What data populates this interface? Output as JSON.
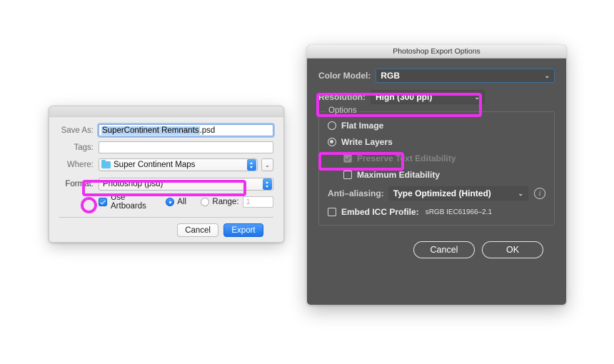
{
  "save_dialog": {
    "name": "macos-save-sheet",
    "save_as": {
      "label": "Save As:",
      "selected_text": "SuperContinent Remnants",
      "extension": ".psd",
      "full_value": "SuperContinent Remnants.psd"
    },
    "tags": {
      "label": "Tags:",
      "value": ""
    },
    "where": {
      "label": "Where:",
      "value": "Super Continent Maps",
      "folder_icon": "folder-icon",
      "stepper_icon": "up-down-stepper-icon",
      "chevron_icon": "chevron-down-icon",
      "chevron_glyph": "⌄"
    },
    "format": {
      "label": "Format:",
      "value": "Photoshop (psd)",
      "stepper_icon": "up-down-stepper-icon"
    },
    "artboards": {
      "checkbox_label": "Use Artboards",
      "checked": true,
      "all_label": "All",
      "all_selected": true,
      "range_label": "Range:",
      "range_selected": false,
      "range_value": "1"
    },
    "buttons": {
      "cancel": "Cancel",
      "export": "Export"
    }
  },
  "ps_dialog": {
    "title": "Photoshop Export Options",
    "color_model": {
      "label": "Color Model:",
      "value": "RGB",
      "chevron_glyph": "⌄"
    },
    "resolution": {
      "label": "Resolution:",
      "value": "High (300 ppi)",
      "chevron_glyph": "⌄"
    },
    "options": {
      "group_title": "Options",
      "flat_image": {
        "label": "Flat Image",
        "selected": false
      },
      "write_layers": {
        "label": "Write Layers",
        "selected": true
      },
      "preserve_text": {
        "label": "Preserve Text Editability",
        "checked": true,
        "disabled": true
      },
      "maximum_editability": {
        "label": "Maximum Editability",
        "checked": false
      },
      "anti_aliasing": {
        "label": "Anti–aliasing:",
        "value": "Type Optimized (Hinted)",
        "chevron_glyph": "⌄",
        "info_icon": "info-icon",
        "info_glyph": "i"
      },
      "embed_icc": {
        "label": "Embed ICC Profile:",
        "checked": false,
        "profile": "sRGB IEC61966–2.1"
      }
    },
    "buttons": {
      "cancel": "Cancel",
      "ok": "OK"
    }
  },
  "annotations": {
    "color": "#ef2ff0",
    "shapes": [
      {
        "name": "highlight-format-popup",
        "type": "rect"
      },
      {
        "name": "highlight-use-artboards-checkbox",
        "type": "ellipse"
      },
      {
        "name": "highlight-resolution-row",
        "type": "rect"
      },
      {
        "name": "highlight-write-layers-option",
        "type": "rect"
      }
    ]
  }
}
